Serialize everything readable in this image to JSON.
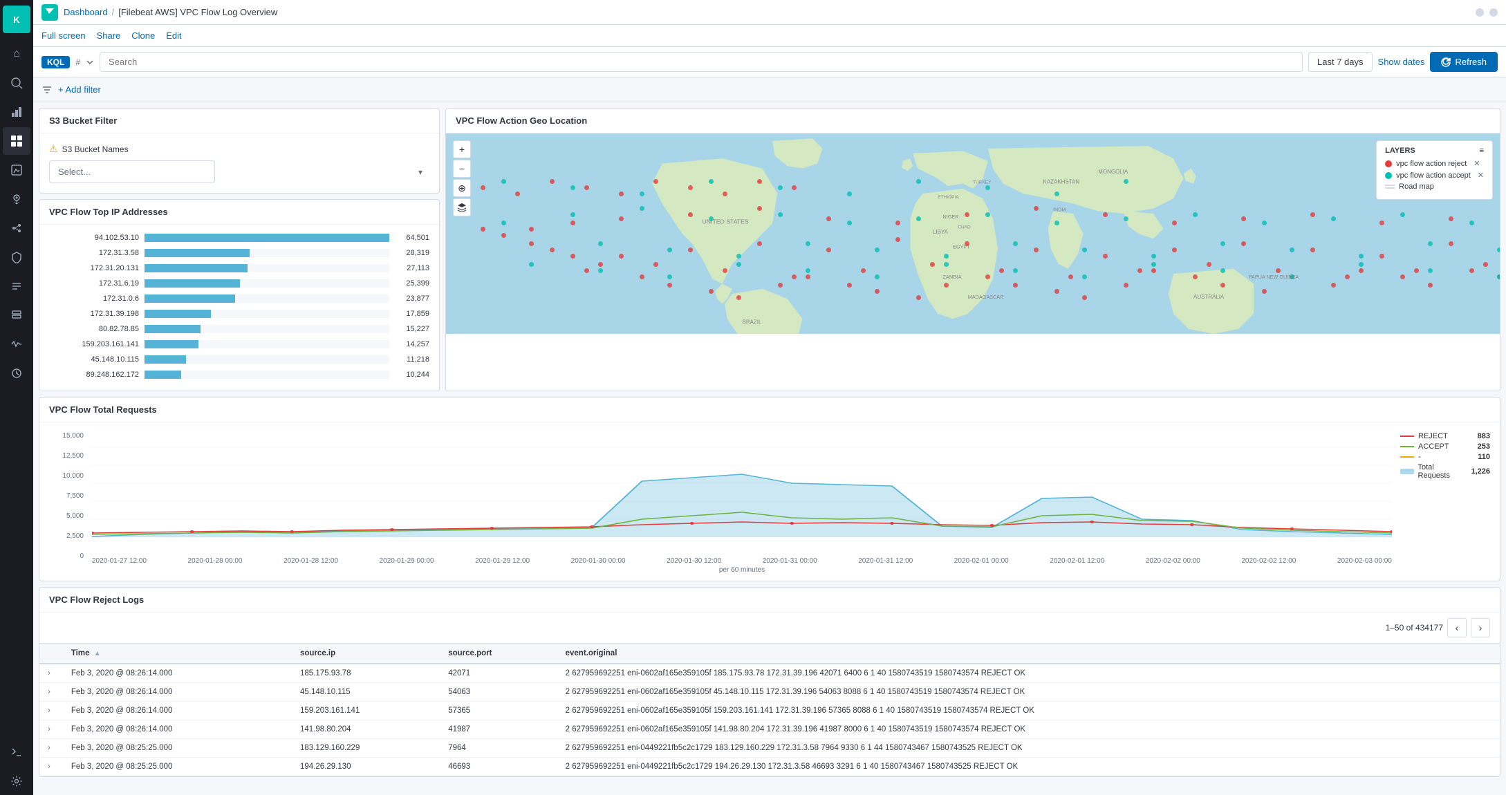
{
  "app": {
    "title": "Dashboard",
    "subtitle": "[Filebeat AWS] VPC Flow Log Overview"
  },
  "nav": {
    "fullscreen": "Full screen",
    "share": "Share",
    "clone": "Clone",
    "edit": "Edit"
  },
  "filterbar": {
    "kql_label": "KQL",
    "search_placeholder": "Search",
    "time_range": "Last 7 days",
    "show_dates": "Show dates",
    "refresh": "Refresh"
  },
  "filter_row": {
    "add_filter": "+ Add filter"
  },
  "s3_panel": {
    "title": "S3 Bucket Filter",
    "bucket_label": "S3 Bucket Names",
    "select_placeholder": "Select..."
  },
  "ip_panel": {
    "title": "VPC Flow Top IP Addresses",
    "rows": [
      {
        "ip": "94.102.53.10",
        "value": 64501,
        "bar_pct": 100
      },
      {
        "ip": "172.31.3.58",
        "value": 28319,
        "bar_pct": 43
      },
      {
        "ip": "172.31.20.131",
        "value": 27113,
        "bar_pct": 42
      },
      {
        "ip": "172.31.6.19",
        "value": 25399,
        "bar_pct": 39
      },
      {
        "ip": "172.31.0.6",
        "value": 23877,
        "bar_pct": 37
      },
      {
        "ip": "172.31.39.198",
        "value": 17859,
        "bar_pct": 27
      },
      {
        "ip": "80.82.78.85",
        "value": 15227,
        "bar_pct": 23
      },
      {
        "ip": "159.203.161.141",
        "value": 14257,
        "bar_pct": 22
      },
      {
        "ip": "45.148.10.115",
        "value": 11218,
        "bar_pct": 17
      },
      {
        "ip": "89.248.162.172",
        "value": 10244,
        "bar_pct": 15
      }
    ]
  },
  "map_panel": {
    "title": "VPC Flow Action Geo Location",
    "layers_title": "LAYERS",
    "legend": [
      {
        "label": "vpc flow action reject",
        "color": "#e53b3b"
      },
      {
        "label": "vpc flow action accept",
        "color": "#00bfb3"
      },
      {
        "label": "Road map",
        "color": null,
        "type": "road"
      }
    ]
  },
  "chart_panel": {
    "title": "VPC Flow Total Requests",
    "x_label": "per 60 minutes",
    "legend": [
      {
        "label": "REJECT",
        "value": "883",
        "color": "#e53b3b"
      },
      {
        "label": "ACCEPT",
        "value": "253",
        "color": "#6db33f"
      },
      {
        "label": "-",
        "value": "110",
        "color": "#f5a700"
      },
      {
        "label": "Total Requests",
        "value": "1,226",
        "color": "#54b3d6"
      }
    ],
    "y_ticks": [
      "15,000",
      "12,500",
      "10,000",
      "7,500",
      "5,000",
      "2,500",
      "0"
    ],
    "x_ticks": [
      "2020-01-27 12:00",
      "2020-01-28 00:00",
      "2020-01-28 12:00",
      "2020-01-29 00:00",
      "2020-01-29 12:00",
      "2020-01-30 00:00",
      "2020-01-30 12:00",
      "2020-01-31 00:00",
      "2020-01-31 12:00",
      "2020-02-01 00:00",
      "2020-02-01 12:00",
      "2020-02-02 00:00",
      "2020-02-02 12:00",
      "2020-02-03 00:00"
    ]
  },
  "logs_panel": {
    "title": "VPC Flow Reject Logs",
    "pagination": "1–50 of 434177",
    "columns": [
      "Time",
      "source.ip",
      "source.port",
      "event.original"
    ],
    "rows": [
      {
        "time": "Feb 3, 2020 @ 08:26:14.000",
        "source_ip": "185.175.93.78",
        "source_port": "42071",
        "event": "2 627959692251 eni-0602af165e359105f 185.175.93.78 172.31.39.196 42071 6400 6 1 40 1580743519 1580743574 REJECT OK"
      },
      {
        "time": "Feb 3, 2020 @ 08:26:14.000",
        "source_ip": "45.148.10.115",
        "source_port": "54063",
        "event": "2 627959692251 eni-0602af165e359105f 45.148.10.115 172.31.39.196 54063 8088 6 1 40 1580743519 1580743574 REJECT OK"
      },
      {
        "time": "Feb 3, 2020 @ 08:26:14.000",
        "source_ip": "159.203.161.141",
        "source_port": "57365",
        "event": "2 627959692251 eni-0602af165e359105f 159.203.161.141 172.31.39.196 57365 8088 6 1 40 1580743519 1580743574 REJECT OK"
      },
      {
        "time": "Feb 3, 2020 @ 08:26:14.000",
        "source_ip": "141.98.80.204",
        "source_port": "41987",
        "event": "2 627959692251 eni-0602af165e359105f 141.98.80.204 172.31.39.196 41987 8000 6 1 40 1580743519 1580743574 REJECT OK"
      },
      {
        "time": "Feb 3, 2020 @ 08:25:25.000",
        "source_ip": "183.129.160.229",
        "source_port": "7964",
        "event": "2 627959692251 eni-0449221fb5c2c1729 183.129.160.229 172.31.3.58 7964 9330 6 1 44 1580743467 1580743525 REJECT OK"
      },
      {
        "time": "Feb 3, 2020 @ 08:25:25.000",
        "source_ip": "194.26.29.130",
        "source_port": "46693",
        "event": "2 627959692251 eni-0449221fb5c2c1729 194.26.29.130 172.31.3.58 46693 3291 6 1 40 1580743467 1580743525 REJECT OK"
      }
    ]
  },
  "sidebar": {
    "icons": [
      {
        "name": "home-icon",
        "symbol": "⌂",
        "active": false
      },
      {
        "name": "discover-icon",
        "symbol": "🔍",
        "active": false
      },
      {
        "name": "visualize-icon",
        "symbol": "📊",
        "active": false
      },
      {
        "name": "dashboard-icon",
        "symbol": "▦",
        "active": true
      },
      {
        "name": "canvas-icon",
        "symbol": "◻",
        "active": false
      },
      {
        "name": "maps-icon",
        "symbol": "◉",
        "active": false
      },
      {
        "name": "ml-icon",
        "symbol": "⚙",
        "active": false
      },
      {
        "name": "siem-icon",
        "symbol": "🛡",
        "active": false
      },
      {
        "name": "logs-icon",
        "symbol": "≡",
        "active": false
      },
      {
        "name": "infra-icon",
        "symbol": "◈",
        "active": false
      },
      {
        "name": "apm-icon",
        "symbol": "◆",
        "active": false
      },
      {
        "name": "uptime-icon",
        "symbol": "↑",
        "active": false
      },
      {
        "name": "dev-tools-icon",
        "symbol": "✦",
        "active": false
      },
      {
        "name": "settings-icon",
        "symbol": "⚙",
        "active": false
      }
    ]
  }
}
